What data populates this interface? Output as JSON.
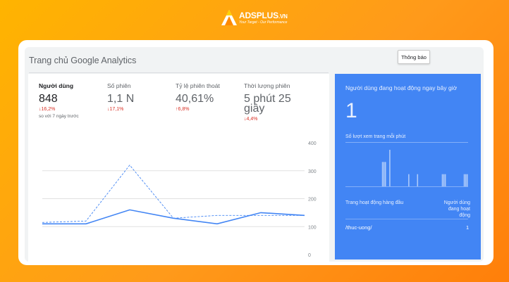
{
  "brand": {
    "name_main": "ADSPLUS",
    "name_suffix": ".VN",
    "tagline": "Your Target - Our Performance",
    "colors": {
      "mark_orange": "#ff8a00",
      "mark_white": "#ffffff"
    }
  },
  "header": {
    "title": "Trang chủ Google Analytics",
    "notification_button": "Thông báo"
  },
  "metrics": [
    {
      "label": "Người dùng",
      "value": "848",
      "change": "↓16,2%",
      "direction": "down",
      "compare": "so với 7 ngày trước",
      "active": true
    },
    {
      "label": "Số phiên",
      "value": "1,1 N",
      "change": "↓17,1%",
      "direction": "down"
    },
    {
      "label": "Tỷ lệ phiên thoát",
      "value": "40,61%",
      "change": "↑6,8%",
      "direction": "up"
    },
    {
      "label": "Thời lượng phiên",
      "value": "5 phút 25 giây",
      "change": "↓4,4%",
      "direction": "down"
    }
  ],
  "chart_data": {
    "type": "line",
    "ylim": [
      0,
      400
    ],
    "y_ticks": [
      "400",
      "300",
      "200",
      "100",
      "0"
    ],
    "grid": true,
    "series": [
      {
        "style": "solid",
        "color": "#4285f4",
        "values": [
          110,
          110,
          160,
          130,
          110,
          150,
          140
        ]
      },
      {
        "style": "dashed",
        "color": "#4285f4",
        "values": [
          115,
          120,
          320,
          130,
          140,
          140,
          140
        ]
      }
    ]
  },
  "realtime": {
    "title": "Người dùng đang hoạt động ngay bây giờ",
    "count": "1",
    "views_label": "Số lượt xem trang mỗi phút",
    "bars": [
      0,
      0,
      0,
      0,
      0,
      0,
      0,
      0,
      0,
      0,
      0,
      0,
      0,
      0,
      0,
      0,
      0,
      0,
      0,
      0,
      0,
      0,
      0,
      0,
      0,
      2,
      2,
      2,
      0,
      0,
      3,
      0,
      0,
      0,
      0,
      0,
      0,
      0,
      0,
      0,
      0,
      0,
      0,
      1,
      0,
      0,
      0,
      0,
      0,
      1,
      0,
      0,
      0,
      0,
      0,
      0,
      0,
      0,
      0,
      0,
      0,
      0,
      0,
      0,
      0,
      0,
      1,
      1,
      1,
      0,
      0,
      0,
      0,
      0,
      0,
      0,
      0,
      0,
      0,
      0,
      0,
      1,
      1,
      1
    ],
    "table_head_page": "Trang hoạt động hàng đầu",
    "table_head_users": "Người dùng đang hoạt động",
    "rows": [
      {
        "page": "/thuc-uong/",
        "users": "1"
      }
    ]
  }
}
